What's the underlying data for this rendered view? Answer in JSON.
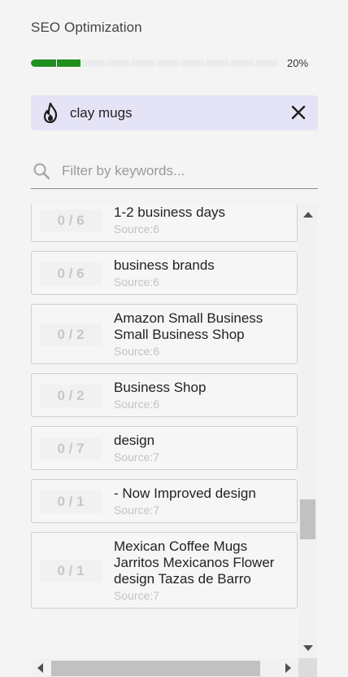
{
  "panel": {
    "title": "SEO Optimization"
  },
  "progress": {
    "value": 0.2,
    "label": "20%",
    "color": "#1f8f1f",
    "segments": 10
  },
  "active_keyword": {
    "text": "clay mugs",
    "icon": "flame-icon",
    "close_icon": "close-icon"
  },
  "filter": {
    "placeholder": "Filter by keywords...",
    "value": "",
    "icon": "search-icon"
  },
  "keywords": [
    {
      "count": "0 / 6",
      "lines": [
        "1-2 business days"
      ],
      "source": "Source:6"
    },
    {
      "count": "0 / 6",
      "lines": [
        "business brands"
      ],
      "source": "Source:6"
    },
    {
      "count": "0 / 2",
      "lines": [
        "Amazon Small Business",
        "Small Business Shop"
      ],
      "source": "Source:6"
    },
    {
      "count": "0 / 2",
      "lines": [
        "Business Shop"
      ],
      "source": "Source:6"
    },
    {
      "count": "0 / 7",
      "lines": [
        "design"
      ],
      "source": "Source:7"
    },
    {
      "count": "0 / 1",
      "lines": [
        "- Now Improved design"
      ],
      "source": "Source:7"
    },
    {
      "count": "0 / 1",
      "lines": [
        "Mexican Coffee Mugs",
        "Jarritos Mexicanos Flower",
        "design Tazas de Barro"
      ],
      "source": "Source:7"
    }
  ]
}
